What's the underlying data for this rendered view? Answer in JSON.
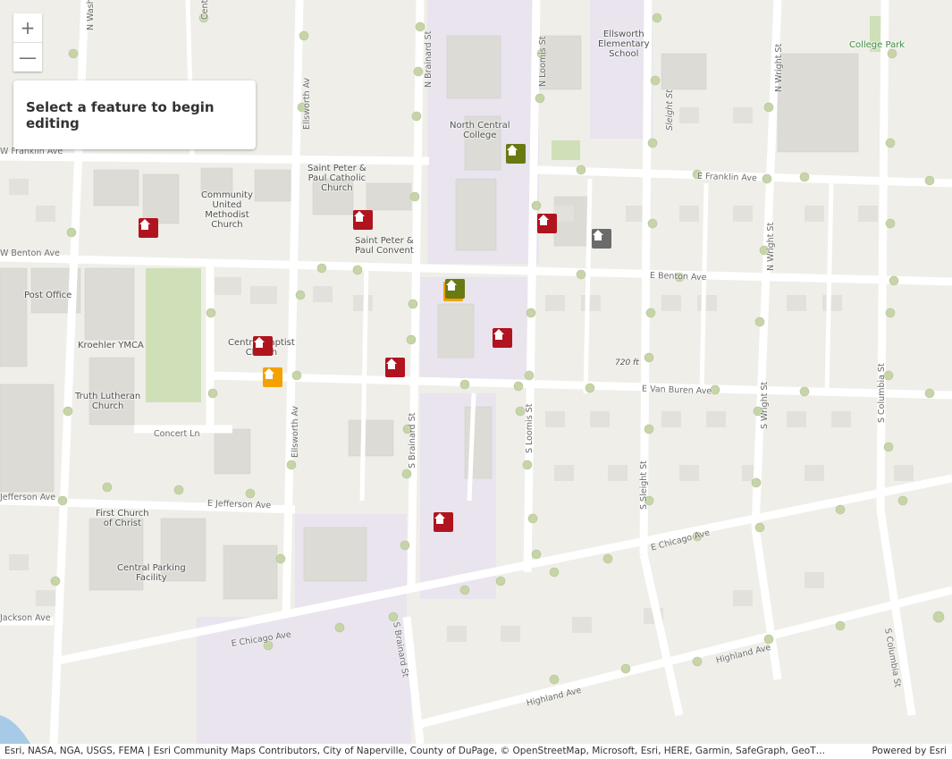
{
  "zoom": {
    "in_label": "+",
    "out_label": "—"
  },
  "editor": {
    "prompt": "Select a feature to begin editing"
  },
  "attribution": {
    "sources": "Esri, NASA, NGA, USGS, FEMA | Esri Community Maps Contributors, City of Naperville, County of DuPage, © OpenStreetMap, Microsoft, Esri, HERE, Garmin, SafeGraph, GeoT…",
    "powered_by": "Powered by Esri"
  },
  "pois": {
    "ellsworth_school": "Ellsworth\nElementary\nSchool",
    "college_park": "College Park",
    "north_central": "North Central\nCollege",
    "st_peter_paul_church": "Saint Peter &\nPaul Catholic\nChurch",
    "community_methodist": "Community\nUnited\nMethodist\nChurch",
    "st_peter_paul_convent": "Saint Peter &\nPaul Convent",
    "post_office": "Post Office",
    "kroehler_ymca": "Kroehler YMCA",
    "central_baptist": "Central Baptist\nChurch",
    "truth_lutheran": "Truth Lutheran\nChurch",
    "first_church_christ": "First Church\nof Christ",
    "central_parking": "Central Parking\nFacility",
    "elevation": "720 ft"
  },
  "streets": {
    "w_franklin": "W Franklin Ave",
    "e_franklin": "E Franklin Ave",
    "w_benton": "W Benton Ave",
    "e_benton": "E Benton Ave",
    "e_van_buren": "E Van Buren Ave",
    "concert": "Concert Ln",
    "w_jefferson": "Jefferson Ave",
    "e_jefferson": "E Jefferson Ave",
    "e_chicago_1": "E Chicago Ave",
    "e_chicago_2": "E Chicago Ave",
    "highland_1": "Highland Ave",
    "highland_2": "Highland Ave",
    "jackson": "Jackson Ave",
    "n_washington": "N Wash",
    "n_brainard": "N Brainard St",
    "s_brainard_1": "S Brainard St",
    "s_brainard_2": "S Brainard St",
    "ellsworth_n": "Ellsworth Av",
    "ellsworth_s": "Ellsworth Av",
    "n_loomis": "N Loomis St",
    "s_loomis": "S Loomis St",
    "sleight_n": "Sleight St",
    "s_sleight": "S Sleight St",
    "n_wright_1": "N Wright St",
    "n_wright_2": "N Wright St",
    "s_wright": "S Wright St",
    "s_columbia_1": "S Columbia St",
    "s_columbia_2": "S Columbia St",
    "centr": "Centr"
  },
  "markers": [
    {
      "color": "#b0141e",
      "icon": "house-icon"
    },
    {
      "color": "#b0141e",
      "icon": "house-icon"
    },
    {
      "color": "#b0141e",
      "icon": "house-icon"
    },
    {
      "color": "#6b6b6b",
      "icon": "house-icon"
    },
    {
      "color": "#6a7a12",
      "icon": "house-icon"
    },
    {
      "color": "#6a7a12",
      "icon": "house-icon"
    },
    {
      "color": "#b0141e",
      "icon": "house-icon"
    },
    {
      "color": "#b0141e",
      "icon": "house-icon"
    },
    {
      "color": "#b0141e",
      "icon": "house-icon"
    },
    {
      "color": "#f2a100",
      "icon": "house-icon"
    },
    {
      "color": "#b0141e",
      "icon": "house-icon"
    }
  ]
}
